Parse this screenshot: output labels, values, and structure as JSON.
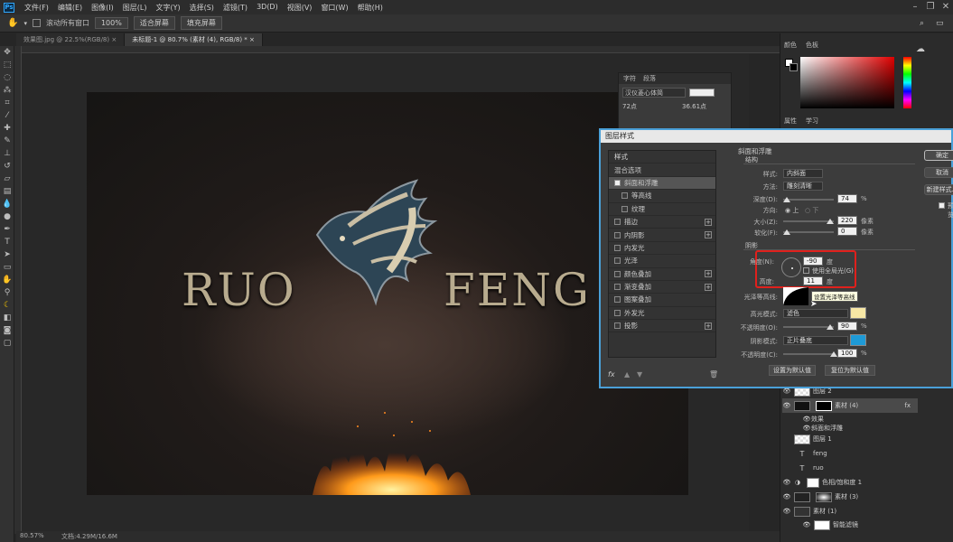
{
  "app": {
    "logo": "Ps"
  },
  "menu": [
    "文件(F)",
    "编辑(E)",
    "图像(I)",
    "图层(L)",
    "文字(Y)",
    "选择(S)",
    "滤镜(T)",
    "3D(D)",
    "视图(V)",
    "窗口(W)",
    "帮助(H)"
  ],
  "options_bar": {
    "scroll_all": "滚动所有窗口",
    "zoom": "100%",
    "fit_screen": "适合屏幕",
    "fill_screen": "填充屏幕"
  },
  "tabs": [
    {
      "label": "效果图.jpg @ 22.5%(RGB/8)",
      "close": "×"
    },
    {
      "label": "未标题-1 @ 80.7% (素材 (4), RGB/8) *",
      "close": "×"
    }
  ],
  "artwork": {
    "word_left": "RUO",
    "word_right": "FENG"
  },
  "status": {
    "zoom": "80.57%",
    "doc": "文档:4.29M/16.6M"
  },
  "character_panel": {
    "tab1": "字符",
    "tab2": "段落",
    "font": "汉仪菱心体简",
    "size": "72点",
    "leading": "36.61点"
  },
  "dock": {
    "color_tab": "颜色",
    "swatches_tab": "色板",
    "adjust_tab": "属性",
    "learn_tab": "学习"
  },
  "dialog": {
    "title": "图层样式",
    "styles_header": "样式",
    "blend_options": "混合选项",
    "style_items": [
      {
        "label": "斜面和浮雕",
        "checked": true,
        "selected": true,
        "plus": false
      },
      {
        "label": "等高线",
        "checked": false,
        "selected": false,
        "plus": false,
        "indent": true
      },
      {
        "label": "纹理",
        "checked": false,
        "selected": false,
        "plus": false,
        "indent": true
      },
      {
        "label": "描边",
        "checked": false,
        "selected": false,
        "plus": true
      },
      {
        "label": "内阴影",
        "checked": false,
        "selected": false,
        "plus": true
      },
      {
        "label": "内发光",
        "checked": false,
        "selected": false,
        "plus": false
      },
      {
        "label": "光泽",
        "checked": false,
        "selected": false,
        "plus": false
      },
      {
        "label": "颜色叠加",
        "checked": false,
        "selected": false,
        "plus": true
      },
      {
        "label": "渐变叠加",
        "checked": false,
        "selected": false,
        "plus": true
      },
      {
        "label": "图案叠加",
        "checked": false,
        "selected": false,
        "plus": false
      },
      {
        "label": "外发光",
        "checked": false,
        "selected": false,
        "plus": false
      },
      {
        "label": "投影",
        "checked": false,
        "selected": false,
        "plus": true
      }
    ],
    "section_title": "斜面和浮雕",
    "structure": "结构",
    "style_label": "样式:",
    "style_value": "内斜面",
    "technique_label": "方法:",
    "technique_value": "雕刻清晰",
    "depth_label": "深度(D):",
    "depth_value": "74",
    "direction_label": "方向:",
    "up_label": "上",
    "down_label": "下",
    "size_label": "大小(Z):",
    "size_value": "220",
    "soften_label": "软化(F):",
    "soften_value": "0",
    "shading": "阴影",
    "angle_label": "角度(N):",
    "angle_value": "-90",
    "global_light": "使用全局光(G)",
    "altitude_label": "高度:",
    "altitude_value": "11",
    "gloss_label": "光泽等高线:",
    "tooltip": "设置光泽等高线",
    "highlight_mode_label": "高光模式:",
    "highlight_mode": "滤色",
    "highlight_opacity_label": "不透明度(O):",
    "highlight_opacity": "90",
    "shadow_mode_label": "阴影模式:",
    "shadow_mode": "正片叠底",
    "shadow_opacity_label": "不透明度(C):",
    "shadow_opacity": "100",
    "make_default": "设置为默认值",
    "reset_default": "复位为默认值",
    "unit_px": "像素",
    "unit_pct": "%",
    "unit_deg": "度",
    "fx": "fx",
    "ok": "确定",
    "cancel": "取消",
    "new_style": "新建样式...",
    "preview": "预览"
  },
  "layers": [
    {
      "name": "图层 2",
      "eye": true
    },
    {
      "name": "素材 (4)",
      "eye": true,
      "fx": true
    },
    {
      "name": "效果",
      "eye": true,
      "sub": true
    },
    {
      "name": "斜面和浮雕",
      "eye": true,
      "sub": true
    },
    {
      "name": "图层 1",
      "eye": false
    },
    {
      "name": "feng",
      "eye": false,
      "text": true
    },
    {
      "name": "ruo",
      "eye": false,
      "text": true
    },
    {
      "name": "色相/饱和度 1",
      "eye": true
    },
    {
      "name": "素材 (3)",
      "eye": true
    },
    {
      "name": "素材 (1)",
      "eye": true
    },
    {
      "name": "智能滤镜",
      "eye": true,
      "sub": true
    }
  ],
  "colors": {
    "highlight": "#f7e7a5",
    "shadow": "#1e9ad6",
    "accent": "#31a8ff",
    "annot": "#e0201c"
  }
}
